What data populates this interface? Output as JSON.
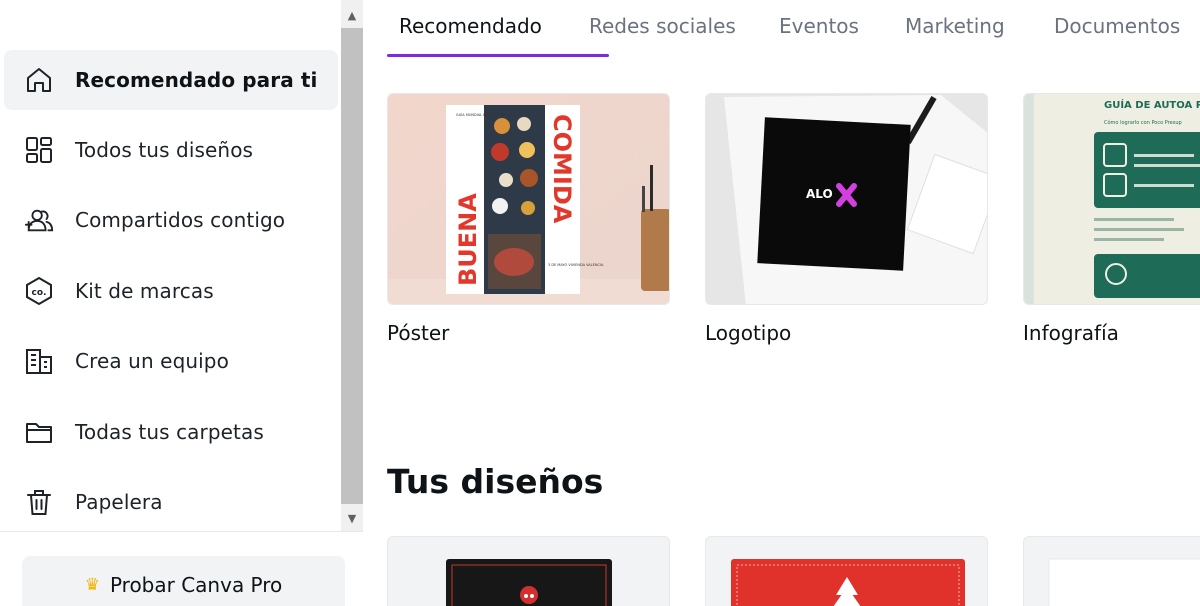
{
  "sidebar": {
    "items": [
      {
        "label": "Recomendado para ti",
        "icon": "home-icon"
      },
      {
        "label": "Todos tus diseños",
        "icon": "grid-icon"
      },
      {
        "label": "Compartidos contigo",
        "icon": "shared-users-icon"
      },
      {
        "label": "Kit de marcas",
        "icon": "brand-kit-icon"
      },
      {
        "label": "Crea un equipo",
        "icon": "building-icon"
      },
      {
        "label": "Todas tus carpetas",
        "icon": "folder-icon"
      },
      {
        "label": "Papelera",
        "icon": "trash-icon"
      }
    ],
    "pro_button": {
      "label": "Probar Canva Pro",
      "icon": "crown-icon"
    }
  },
  "tabs": [
    "Recomendado",
    "Redes sociales",
    "Eventos",
    "Marketing",
    "Documentos"
  ],
  "cards": [
    {
      "label": "Póster",
      "poster": {
        "side_word_1": "BUENA",
        "side_word_2": "COMIDA",
        "top_text": "GUÍA MUNDIAL DE LA COMIDA 200",
        "bottom_text": "3 DE MAYO VIVIENDA VALENCIA"
      }
    },
    {
      "label": "Logotipo",
      "logo_text": "ALO"
    },
    {
      "label": "Infografía",
      "headline": "GUÍA DE AUTOA PARA CHICAS SIN B",
      "subhead": "Cómo lograrlo con Poco Presup"
    }
  ],
  "section_title": "Tus diseños",
  "colors": {
    "accent": "#7d2ae8",
    "poster_red": "#e2382b",
    "logo_magenta": "#d43fe0",
    "infographic_green": "#1e6b57"
  }
}
